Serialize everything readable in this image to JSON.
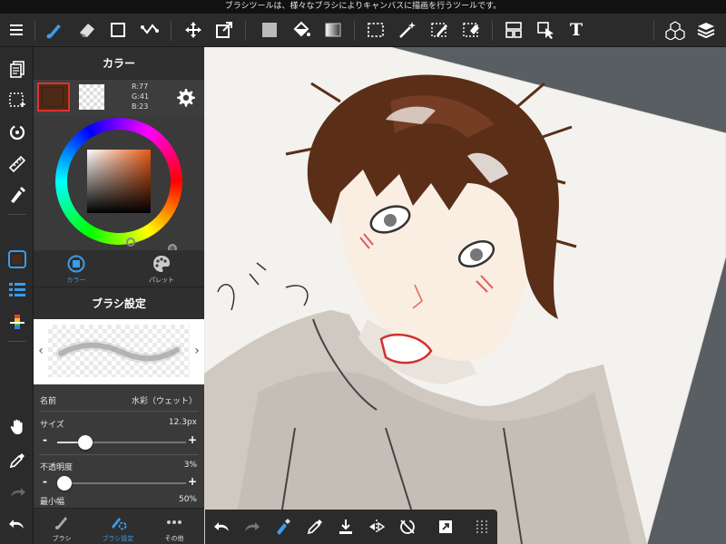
{
  "status_bar": {
    "text": "ブラシツールは、様々なブラシによりキャンバスに描画を行うツールです。"
  },
  "color_panel": {
    "title": "カラー",
    "main_color": "#4d2917",
    "rgb": {
      "r": "R:77",
      "g": "G:41",
      "b": "B:23"
    },
    "tabs": [
      {
        "label": "カラー",
        "active": true
      },
      {
        "label": "パレット",
        "active": false
      }
    ]
  },
  "brush_panel": {
    "title": "ブラシ設定",
    "name_label": "名前",
    "name_value": "水彩（ウェット）",
    "size_label": "サイズ",
    "size_value": "12.3px",
    "size_fraction": 0.22,
    "opacity_label": "不透明度",
    "opacity_value": "3%",
    "opacity_fraction": 0.03,
    "min_width_label": "最小幅",
    "min_width_value": "50%",
    "minus": "-",
    "plus": "+"
  },
  "panel_tabs": [
    {
      "label": "ブラシ",
      "active": false
    },
    {
      "label": "ブラシ設定",
      "active": true
    },
    {
      "label": "その他",
      "active": false
    }
  ],
  "toolbar": {
    "text_tool_glyph": "T",
    "accent_color": "#3d9be9"
  }
}
